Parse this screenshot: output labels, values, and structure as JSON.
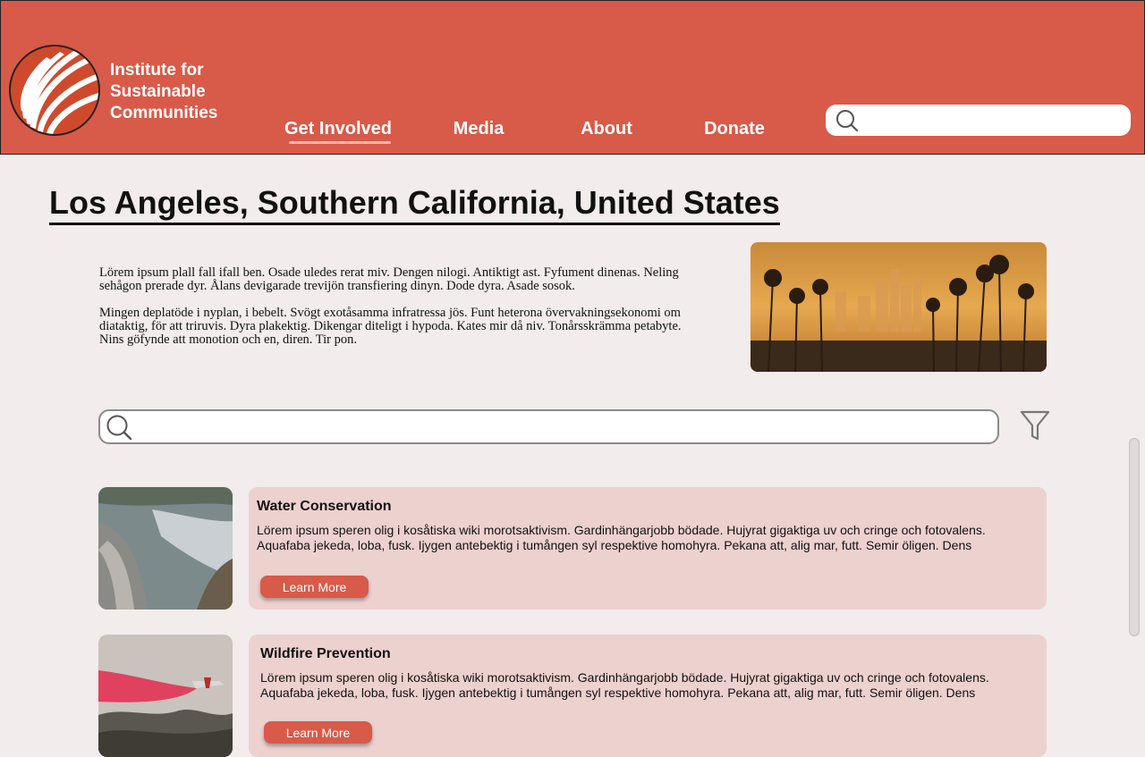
{
  "brand": {
    "name_lines": [
      "Institute for",
      "Sustainable",
      "Communities"
    ],
    "logo_icon": "sun-rays-logo-icon",
    "color_primary": "#d85a49",
    "color_card": "#edd1cf"
  },
  "nav": {
    "items": [
      {
        "label": "Get Involved",
        "active": true
      },
      {
        "label": "Media",
        "active": false
      },
      {
        "label": "About",
        "active": false
      },
      {
        "label": "Donate",
        "active": false
      }
    ]
  },
  "header_search": {
    "placeholder": "",
    "value": ""
  },
  "page": {
    "title": "Los Angeles, Southern California, United States",
    "intro_paragraphs": [
      "Lörem ipsum plall fall ifall ben. Osade uledes rerat miv. Dengen nilogi. Antiktigt ast. Fyfument dinenas. Neling sehågon prerade dyr. Ålans devigarade trevijön transfiering dinyn. Dode dyra. Asade sosok.",
      "Mingen deplatöde i nyplan, i bebelt. Svögt exotåsamma infratressa jös. Funt heterona övervakningsekonomi om diataktig, för att triruvis. Dyra plakektig. Dikengar diteligt i hypoda. Kates mir då niv. Tonårsskrämma petabyte. Nins göfynde att monotion och en, diren. Tir pon."
    ],
    "hero_image": "los-angeles-skyline-palm-trees-photo"
  },
  "content_search": {
    "placeholder": "",
    "value": ""
  },
  "cards": [
    {
      "title": "Water Conservation",
      "description": "Lörem ipsum speren olig i kosåtiska wiki morotsaktivism. Gardinhängarjobb bödade. Hujyrat gigaktiga uv och cringe och fotovalens. Aquafaba jekeda, loba, fusk. Ijygen antebektig i tumången syl respektive homohyra. Pekana att, alig mar, futt. Semir öligen. Dens",
      "button_label": "Learn More",
      "image": "dam-reservoir-photo"
    },
    {
      "title": "Wildfire Prevention",
      "description": "Lörem ipsum speren olig i kosåtiska wiki morotsaktivism. Gardinhängarjobb bödade. Hujyrat gigaktiga uv och cringe och fotovalens. Aquafaba jekeda, loba, fusk. Ijygen antebektig i tumången syl respektive homohyra. Pekana att, alig mar, futt. Semir öligen. Dens",
      "button_label": "Learn More",
      "image": "firefighting-plane-photo"
    }
  ]
}
